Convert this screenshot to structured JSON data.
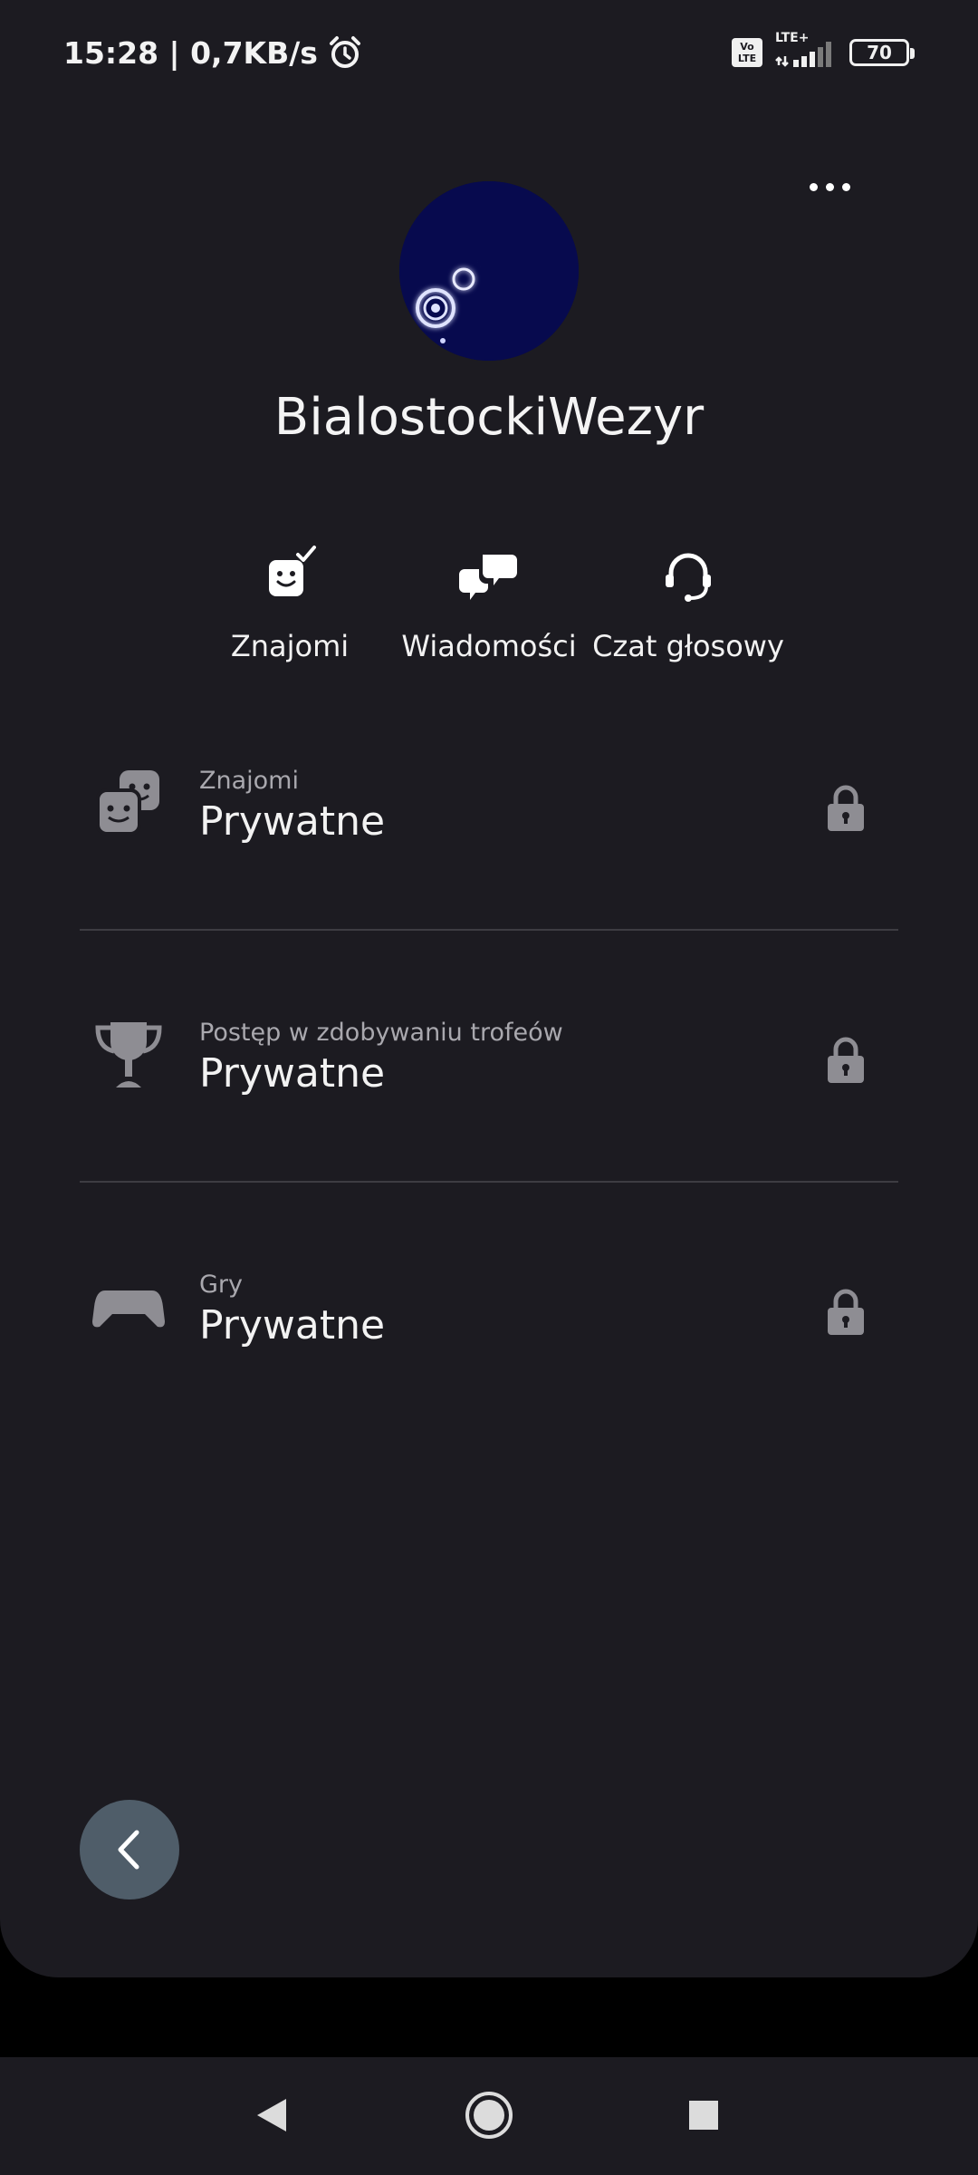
{
  "status_bar": {
    "time": "15:28 | 0,7KB/s",
    "volte_top": "Vo",
    "volte_bottom": "LTE",
    "network_label": "LTE+",
    "battery": "70"
  },
  "profile": {
    "username": "BialostockiWezyr",
    "avatar_colors": {
      "background": "#070a4e",
      "moon": "#ffffff"
    }
  },
  "actions": [
    {
      "label": "Znajomi",
      "icon": "friend-request-icon"
    },
    {
      "label": "Wiadomości",
      "icon": "messages-icon"
    },
    {
      "label": "Czat głosowy",
      "icon": "headset-icon"
    }
  ],
  "privacy": [
    {
      "caption": "Znajomi",
      "value": "Prywatne",
      "icon": "friends-icon"
    },
    {
      "caption": "Postęp w zdobywaniu trofeów",
      "value": "Prywatne",
      "icon": "trophy-icon"
    },
    {
      "caption": "Gry",
      "value": "Prywatne",
      "icon": "gamepad-icon"
    }
  ],
  "colors": {
    "background": "#1c1b21",
    "icon_gray": "#8e8d93",
    "fab": "#4f5d69"
  }
}
